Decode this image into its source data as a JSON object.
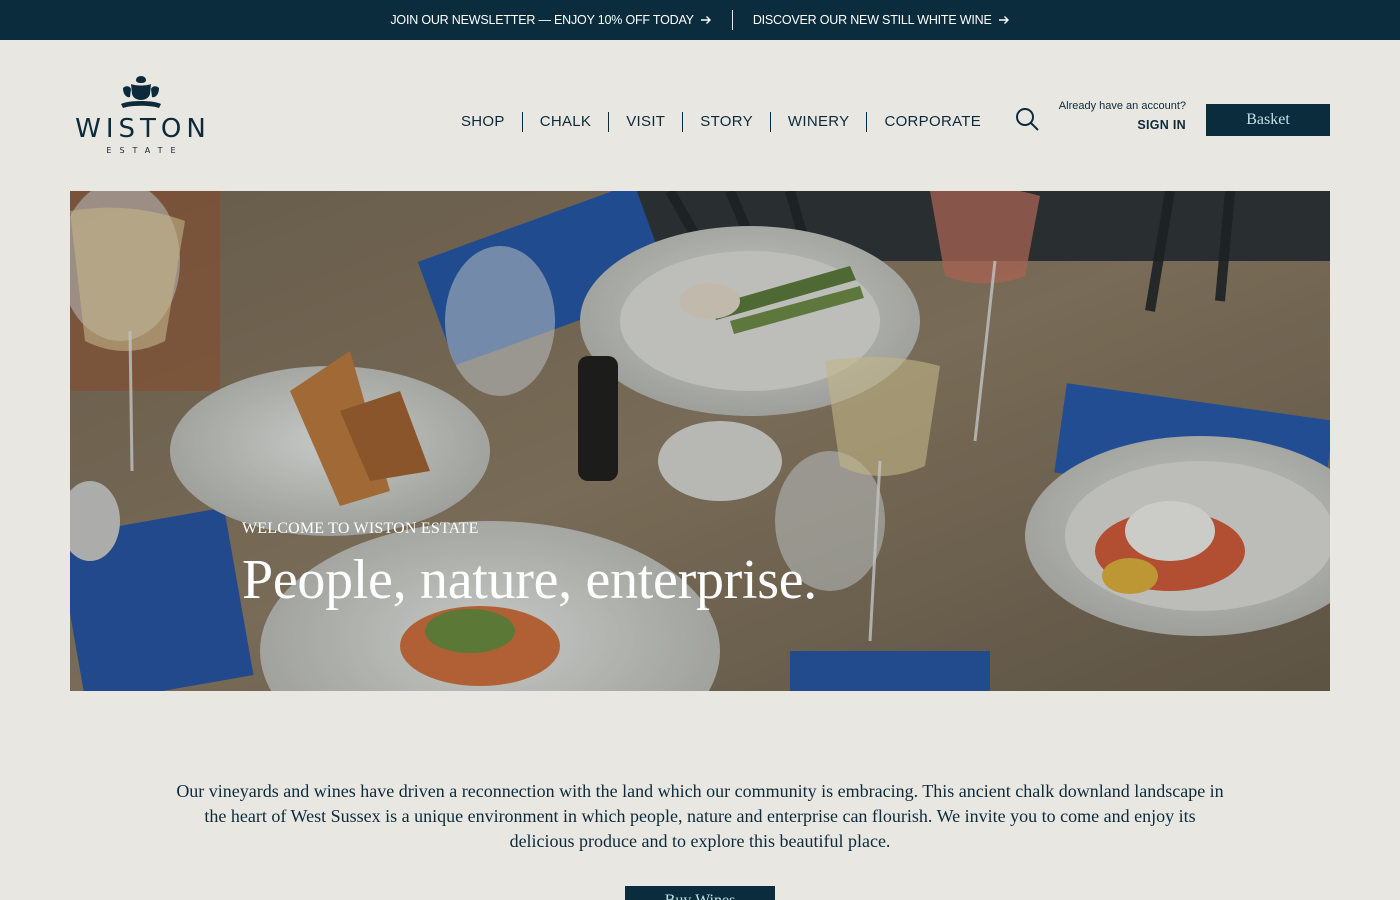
{
  "announcements": [
    {
      "label": "JOIN OUR NEWSLETTER — ENJOY 10% OFF TODAY",
      "icon": "arrow-right-icon"
    },
    {
      "label": "DISCOVER OUR NEW STILL WHITE WINE",
      "icon": "arrow-right-icon"
    }
  ],
  "logo": {
    "name": "WISTON",
    "sub": "ESTATE"
  },
  "nav": [
    "SHOP",
    "CHALK",
    "VISIT",
    "STORY",
    "WINERY",
    "CORPORATE"
  ],
  "search": {
    "icon": "search-icon"
  },
  "account": {
    "prompt": "Already have an account?",
    "signin": "SIGN IN"
  },
  "basket": {
    "label": "Basket"
  },
  "hero": {
    "kicker": "WELCOME TO WISTON ESTATE",
    "headline": "People, nature, enterprise."
  },
  "intro": {
    "text": "Our vineyards and wines have driven a reconnection with the land which our community is embracing. This ancient chalk downland landscape in the heart of  West Sussex is a unique environment in which people, nature and enterprise can flourish. We invite you to come and enjoy its delicious produce and to explore this beautiful place."
  },
  "cta": {
    "label": "Buy Wines"
  },
  "colors": {
    "navy": "#0b2c3d",
    "background": "#e8e7e2",
    "button_text": "#bfe2e8"
  }
}
